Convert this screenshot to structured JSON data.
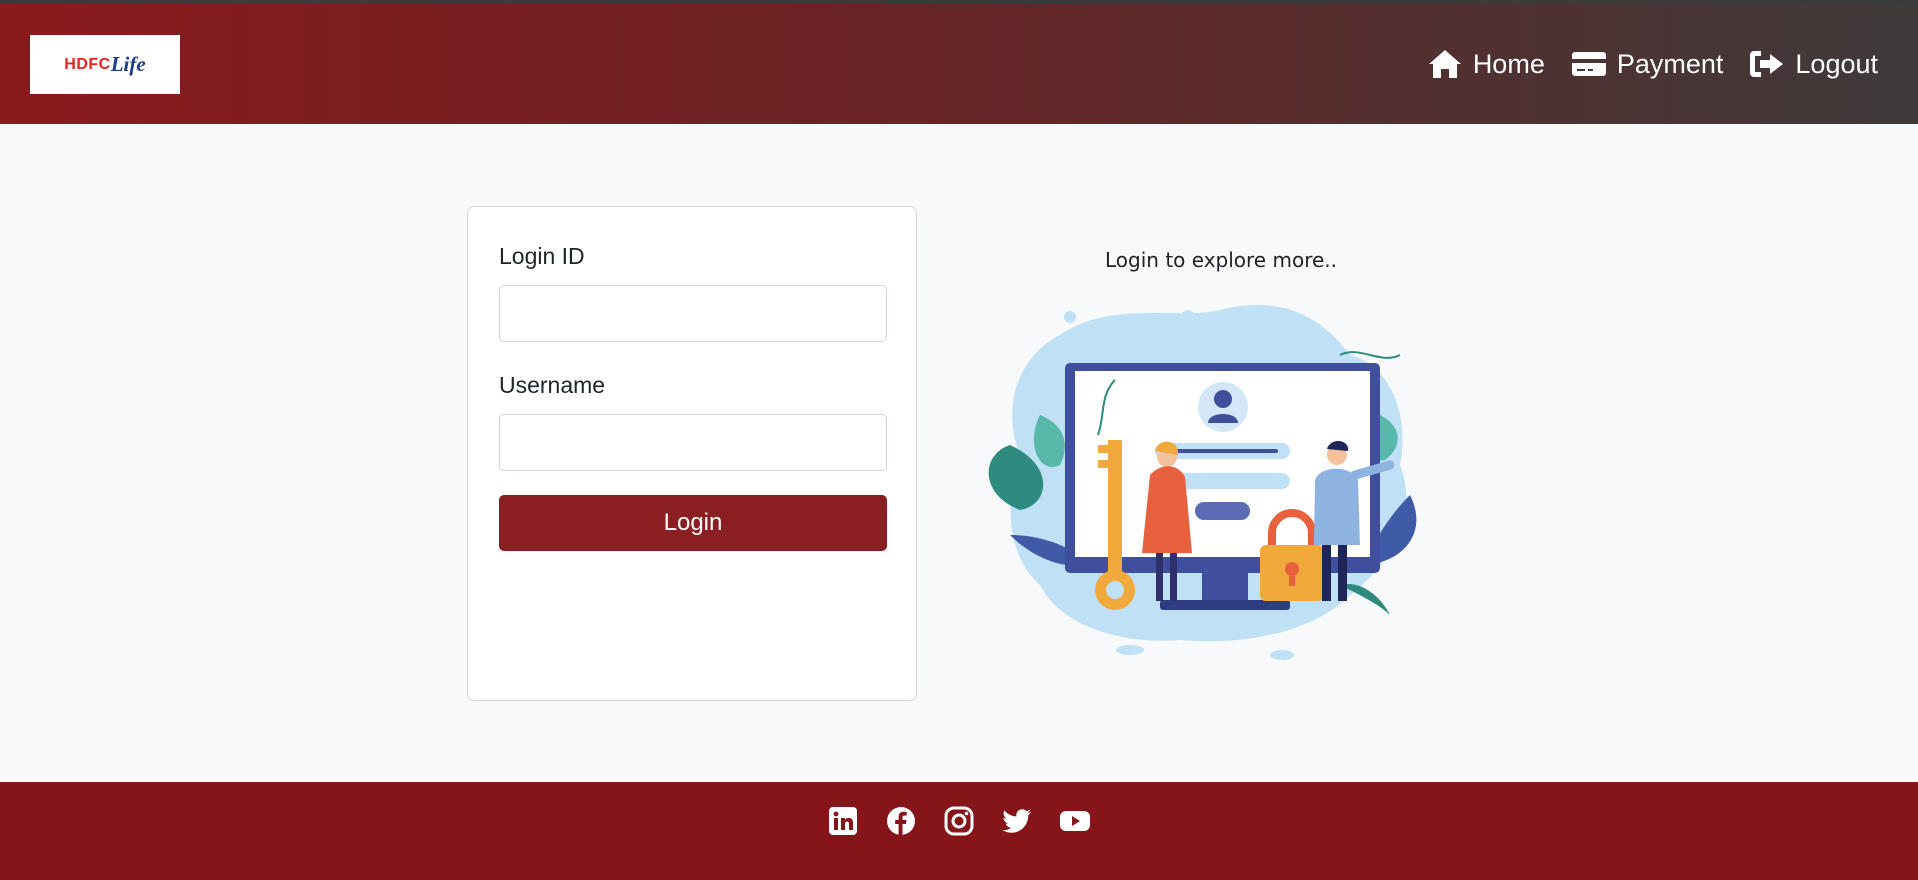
{
  "header": {
    "logo": {
      "text_primary": "HDFC",
      "text_secondary": "Life"
    },
    "nav": [
      {
        "label": "Home",
        "icon": "home-icon"
      },
      {
        "label": "Payment",
        "icon": "credit-card-icon"
      },
      {
        "label": "Logout",
        "icon": "logout-icon"
      }
    ]
  },
  "login_form": {
    "login_id_label": "Login ID",
    "login_id_value": "",
    "username_label": "Username",
    "username_value": "",
    "submit_label": "Login"
  },
  "promo": {
    "tagline": "Login to explore more..",
    "illustration": "login-illustration"
  },
  "footer": {
    "social": [
      "linkedin-icon",
      "facebook-icon",
      "instagram-icon",
      "twitter-icon",
      "youtube-icon"
    ]
  },
  "colors": {
    "brand_red": "#8a1e21",
    "footer_red": "#851518",
    "header_dark": "#3f3a3a"
  }
}
